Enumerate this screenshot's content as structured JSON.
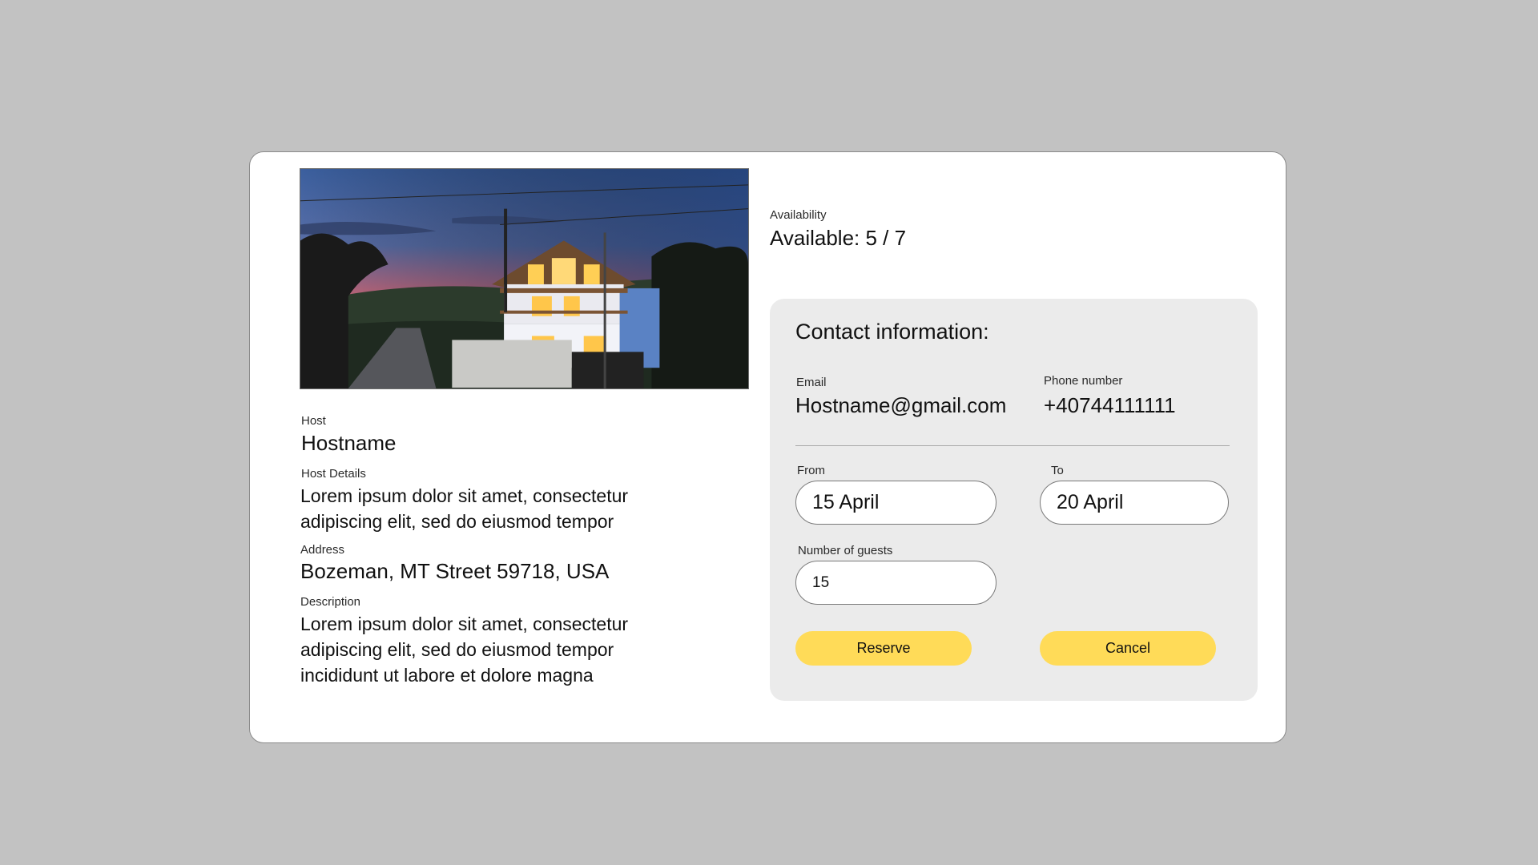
{
  "listing": {
    "photo": "house-at-dusk-photo",
    "host_label": "Host",
    "host_value": "Hostname",
    "host_details_label": "Host Details",
    "host_details_value": "Lorem ipsum dolor sit amet, consectetur adipiscing elit, sed do eiusmod tempor",
    "address_label": "Address",
    "address_value": "Bozeman, MT Street 59718, USA",
    "description_label": "Description",
    "description_value": "Lorem ipsum dolor sit amet, consectetur adipiscing elit, sed do eiusmod tempor incididunt ut labore et dolore magna"
  },
  "availability": {
    "label": "Availability",
    "value": "Available:  5 / 7"
  },
  "contact": {
    "title": "Contact information:",
    "email_label": "Email",
    "email_value": "Hostname@gmail.com",
    "phone_label": "Phone number",
    "phone_value": "+40744111111"
  },
  "booking": {
    "from_label": "From",
    "from_value": "15 April",
    "to_label": "To",
    "to_value": "20 April",
    "guests_label": "Number of guests",
    "guests_value": "15",
    "reserve_label": "Reserve",
    "cancel_label": "Cancel"
  },
  "colors": {
    "background": "#c2c2c2",
    "card": "#ffffff",
    "panel": "#ebebeb",
    "button": "#ffdb58"
  }
}
